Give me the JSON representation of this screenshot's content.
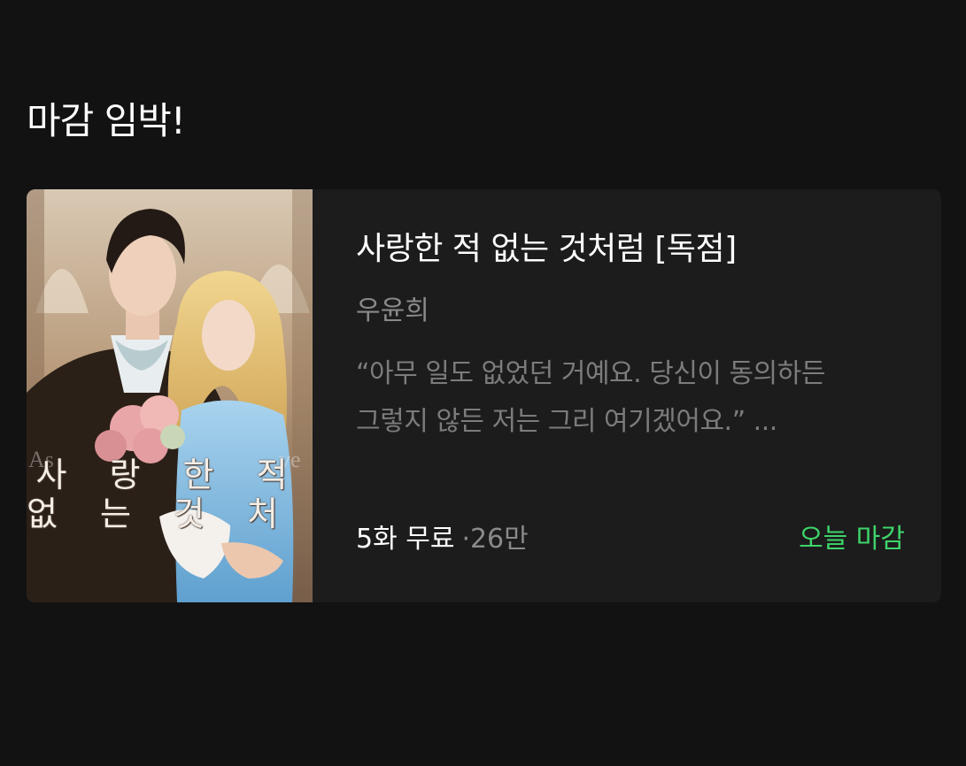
{
  "section": {
    "title": "마감 임박!"
  },
  "card": {
    "cover_title_line1": "사 랑 한  적",
    "cover_title_line2": "없 는  것 처 럼",
    "title": "사랑한 적 없는 것처럼 [독점]",
    "author": "우윤희",
    "synopsis_line1": "“아무 일도 없었던 거예요. 당신이 동의하든",
    "synopsis_line2": "그렇지 않든 저는 그리 여기겠어요.” ...",
    "free_episodes": "5화 무료",
    "views": "·26만",
    "deadline": "오늘 마감"
  },
  "colors": {
    "background": "#121212",
    "card_background": "#1c1c1c",
    "deadline_accent": "#3ed46a"
  }
}
